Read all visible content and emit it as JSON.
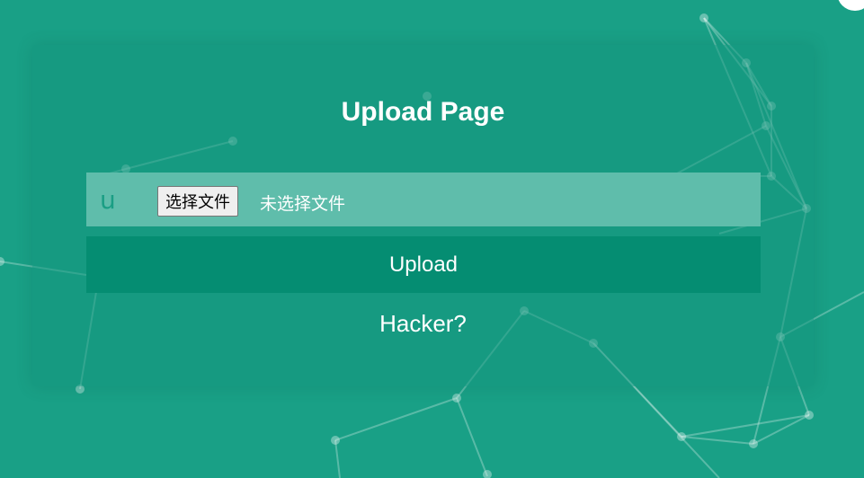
{
  "page": {
    "title": "Upload Page",
    "background_color": "#19a086",
    "accent_color": "#058d72"
  },
  "upload_form": {
    "file_icon_glyph": "u",
    "file_icon_name": "upload-icon",
    "choose_file_label": "选择文件",
    "no_file_text": "未选择文件",
    "submit_label": "Upload"
  },
  "footer_link": {
    "label": "Hacker?"
  }
}
